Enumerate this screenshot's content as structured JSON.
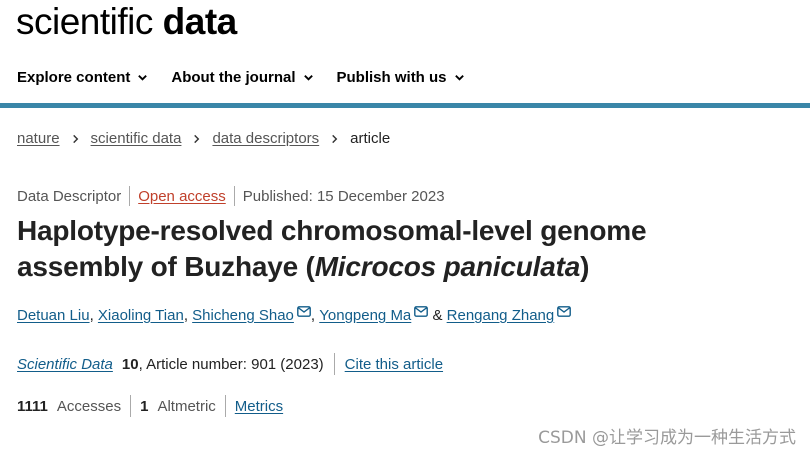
{
  "logo": {
    "regular": "scientific ",
    "bold": "data"
  },
  "nav": [
    {
      "label": "Explore content"
    },
    {
      "label": "About the journal"
    },
    {
      "label": "Publish with us"
    }
  ],
  "breadcrumb": [
    "nature",
    "scientific data",
    "data descriptors",
    "article"
  ],
  "meta": {
    "type": "Data Descriptor",
    "access": "Open access",
    "published": "Published: 15 December 2023"
  },
  "title": {
    "part1": "Haplotype-resolved chromosomal-level genome assembly of Buzhaye (",
    "italic": "Microcos paniculata",
    "part2": ")"
  },
  "authors": [
    "Detuan Liu",
    "Xiaoling Tian",
    "Shicheng Shao",
    "Yongpeng Ma",
    "Rengang Zhang"
  ],
  "authors_sep": {
    "comma": ",",
    "amp": "&"
  },
  "citation": {
    "journal": "Scientific Data",
    "volume": "10",
    "article": ", Article number: 901 (2023)",
    "cite_link": "Cite this article"
  },
  "metrics": {
    "accesses_count": "1111",
    "accesses_label": "Accesses",
    "altmetric_count": "1",
    "altmetric_label": "Altmetric",
    "metrics_link": "Metrics"
  },
  "watermark": "CSDN @让学习成为一种生活方式",
  "colors": {
    "accent_bar": "#3a86a8",
    "link": "#125d8a",
    "open_access": "#c0402b"
  }
}
